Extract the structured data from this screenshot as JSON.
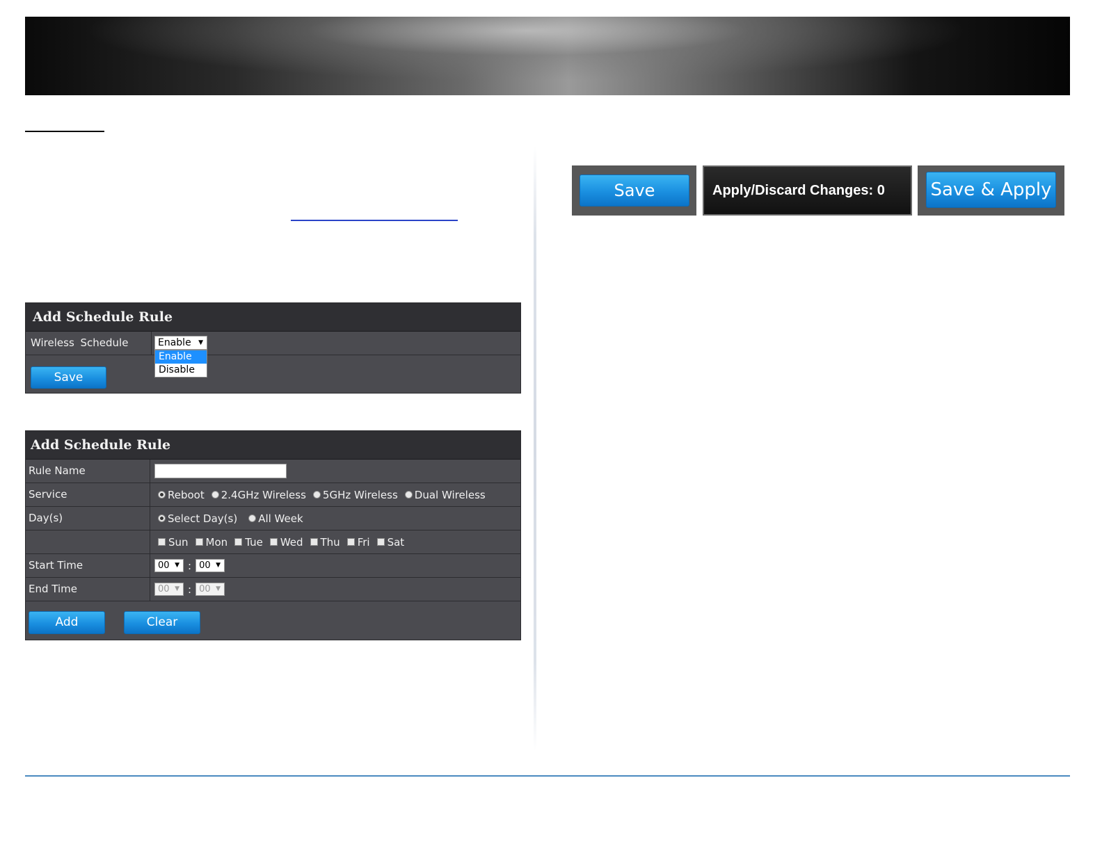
{
  "panel1": {
    "title": "Add Schedule Rule",
    "wireless_schedule_label": "Wireless Schedule",
    "select_value": "Enable",
    "options": [
      "Enable",
      "Disable"
    ],
    "save_label": "Save"
  },
  "panel2": {
    "title": "Add Schedule Rule",
    "rule_name_label": "Rule Name",
    "rule_name_value": "",
    "service_label": "Service",
    "service_options": [
      "Reboot",
      "2.4GHz Wireless",
      "5GHz Wireless",
      "Dual Wireless"
    ],
    "days_label": "Day(s)",
    "days_mode_options": [
      "Select Day(s)",
      "All Week"
    ],
    "weekdays": [
      "Sun",
      "Mon",
      "Tue",
      "Wed",
      "Thu",
      "Fri",
      "Sat"
    ],
    "start_time_label": "Start Time",
    "end_time_label": "End Time",
    "start_hour": "00",
    "start_min": "00",
    "end_hour": "00",
    "end_min": "00",
    "time_sep": ":",
    "add_label": "Add",
    "clear_label": "Clear"
  },
  "actions": {
    "save_label": "Save",
    "apply_discard_label": "Apply/Discard Changes: 0",
    "save_apply_label": "Save & Apply"
  },
  "colors": {
    "panel_bg": "#4b4b50",
    "panel_header": "#2f2f33",
    "button_blue": "#1a8fe0"
  }
}
